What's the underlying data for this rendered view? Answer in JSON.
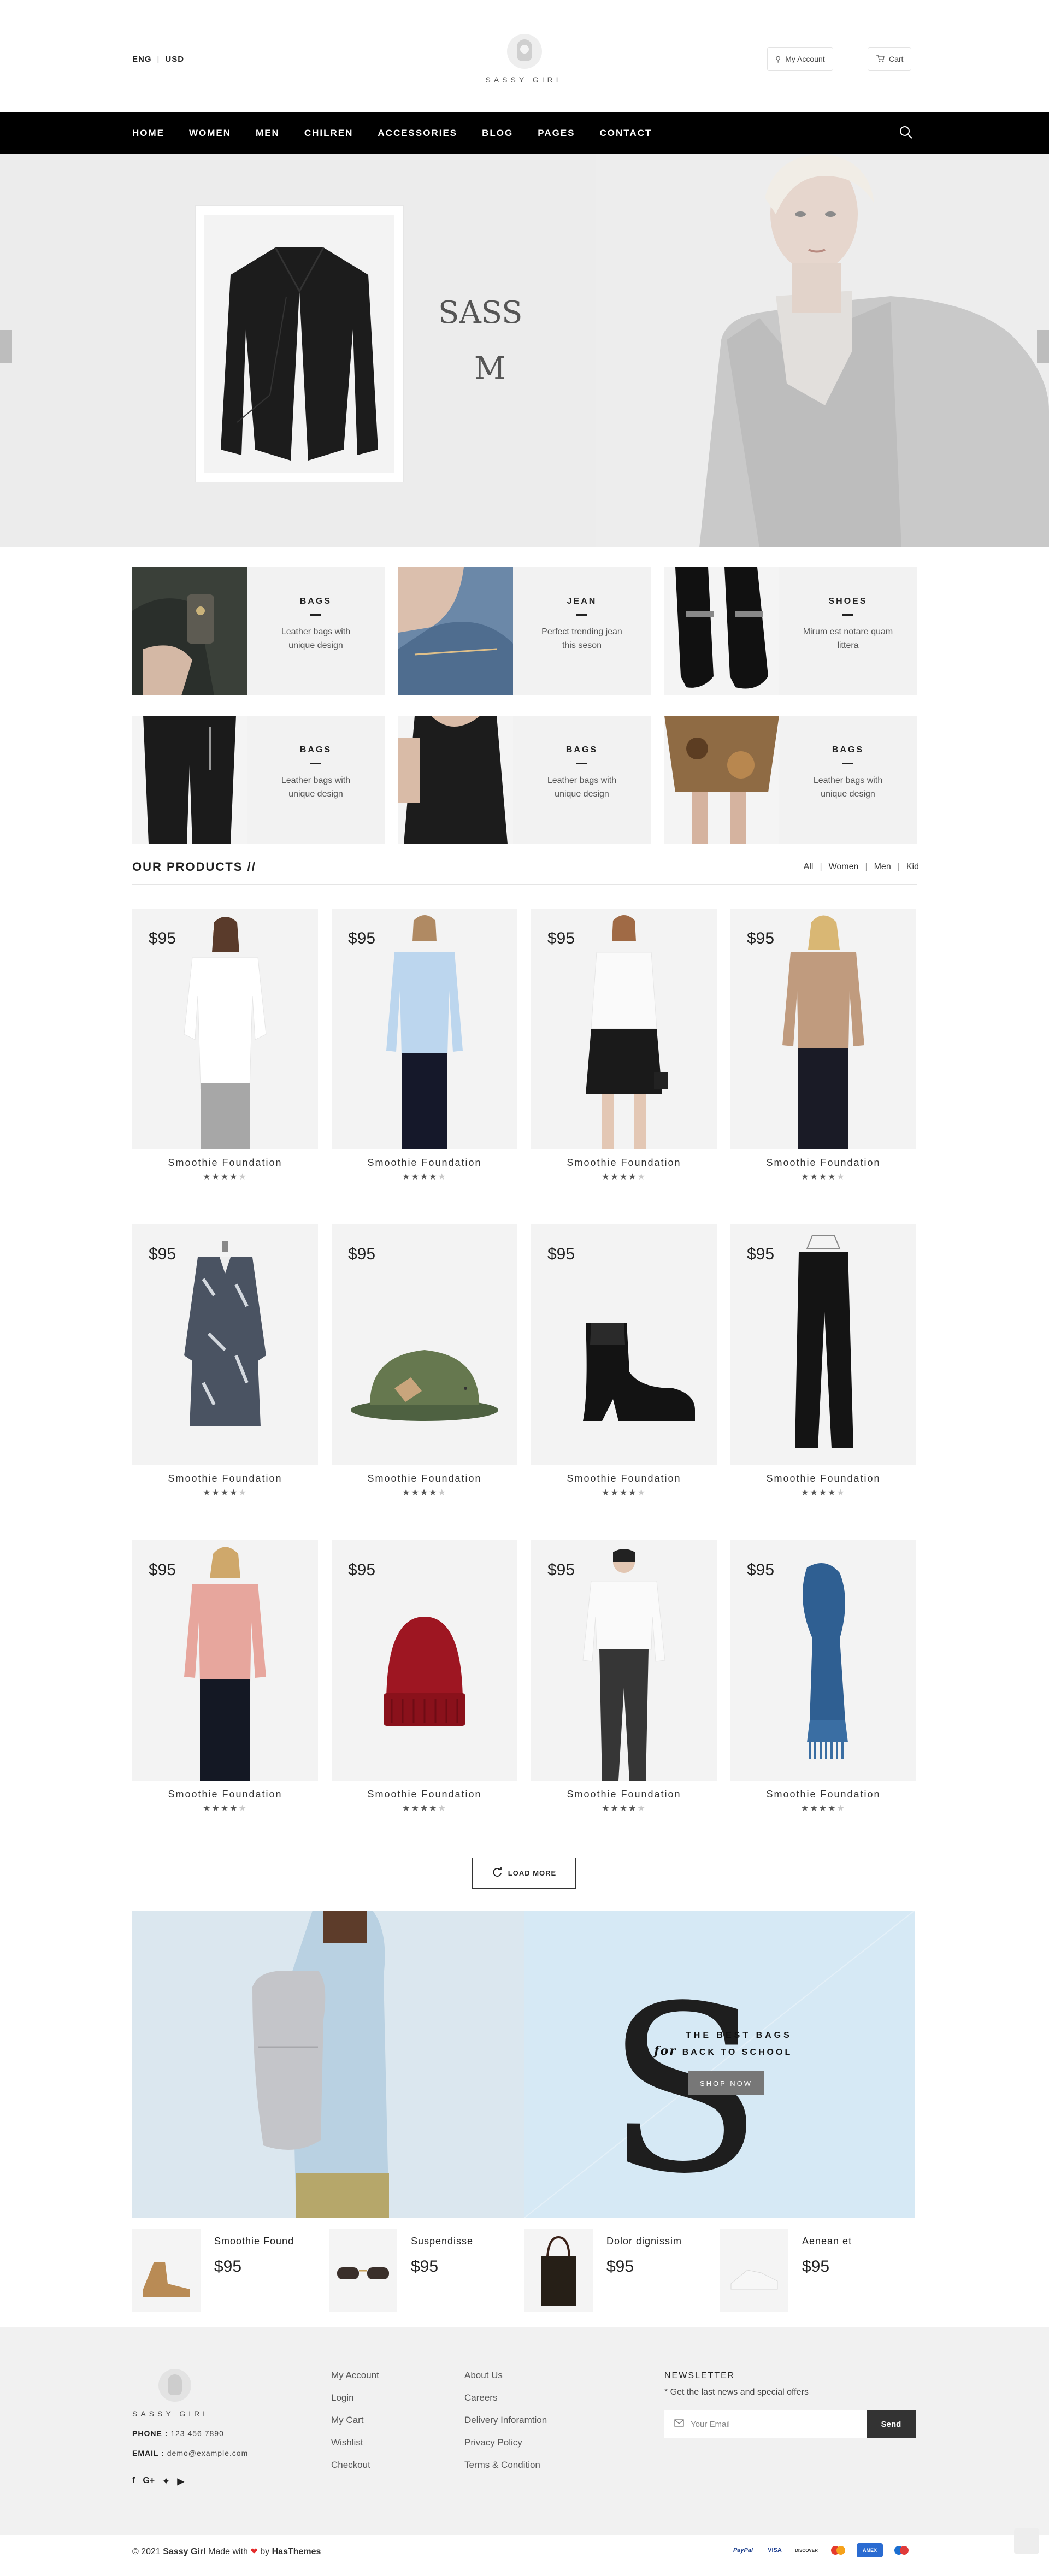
{
  "header": {
    "lang": "ENG",
    "currency": "USD",
    "brand": "SASSY GIRL",
    "account_label": "My Account",
    "cart_label": "Cart"
  },
  "nav": {
    "items": [
      "HOME",
      "WOMEN",
      "MEN",
      "CHILREN",
      "ACCESSORIES",
      "BLOG",
      "PAGES",
      "CONTACT"
    ]
  },
  "hero": {
    "line1": "SASS",
    "line2": "M"
  },
  "categories": [
    {
      "title": "BAGS",
      "desc": "Leather bags with unique design"
    },
    {
      "title": "JEAN",
      "desc": "Perfect trending jean this seson"
    },
    {
      "title": "SHOES",
      "desc": "Mirum est notare quam littera"
    },
    {
      "title": "BAGS",
      "desc": "Leather bags with unique design"
    },
    {
      "title": "BAGS",
      "desc": "Leather bags with unique design"
    },
    {
      "title": "BAGS",
      "desc": "Leather bags with unique design"
    }
  ],
  "products_section": {
    "title": "OUR PRODUCTS //",
    "filters": [
      "All",
      "Women",
      "Men",
      "Kid"
    ]
  },
  "products": [
    {
      "price": "$95",
      "name": "Smoothie Foundation",
      "rating": 4
    },
    {
      "price": "$95",
      "name": "Smoothie Foundation",
      "rating": 4
    },
    {
      "price": "$95",
      "name": "Smoothie Foundation",
      "rating": 4
    },
    {
      "price": "$95",
      "name": "Smoothie Foundation",
      "rating": 4
    },
    {
      "price": "$95",
      "name": "Smoothie Foundation",
      "rating": 4
    },
    {
      "price": "$95",
      "name": "Smoothie Foundation",
      "rating": 4
    },
    {
      "price": "$95",
      "name": "Smoothie Foundation",
      "rating": 4
    },
    {
      "price": "$95",
      "name": "Smoothie Foundation",
      "rating": 4
    },
    {
      "price": "$95",
      "name": "Smoothie Foundation",
      "rating": 4
    },
    {
      "price": "$95",
      "name": "Smoothie Foundation",
      "rating": 4
    },
    {
      "price": "$95",
      "name": "Smoothie Foundation",
      "rating": 4
    },
    {
      "price": "$95",
      "name": "Smoothie Foundation",
      "rating": 4
    }
  ],
  "load_more": "LOAD MORE",
  "banner": {
    "big_letter": "S",
    "line1": "THE BEST BAGS",
    "line2_script": "for",
    "line2": "BACK TO SCHOOL",
    "button": "SHOP NOW"
  },
  "mini_products": [
    {
      "name": "Smoothie Found",
      "price": "$95"
    },
    {
      "name": "Suspendisse",
      "price": "$95"
    },
    {
      "name": "Dolor dignissim",
      "price": "$95"
    },
    {
      "name": "Aenean et",
      "price": "$95"
    }
  ],
  "footer": {
    "brand": "SASSY GIRL",
    "phone_label": "PHONE :",
    "phone": "123 456 7890",
    "email_label": "EMAIL :",
    "email": "demo@example.com",
    "links_col1": [
      "My Account",
      "Login",
      "My Cart",
      "Wishlist",
      "Checkout"
    ],
    "links_col2": [
      "About Us",
      "Careers",
      "Delivery Inforamtion",
      "Privacy Policy",
      "Terms & Condition"
    ],
    "newsletter_title": "NEWSLETTER",
    "newsletter_desc": "* Get the last news and special offers",
    "email_placeholder": "Your Email",
    "send_label": "Send",
    "copyright_prefix": "© 2021",
    "copyright_brand": "Sassy Girl",
    "made_with": "Made with",
    "by": "by",
    "author": "HasThemes",
    "payments": [
      "PayPal",
      "VISA",
      "DISCOVER",
      "mastercard",
      "AMEX",
      "maestro"
    ]
  }
}
